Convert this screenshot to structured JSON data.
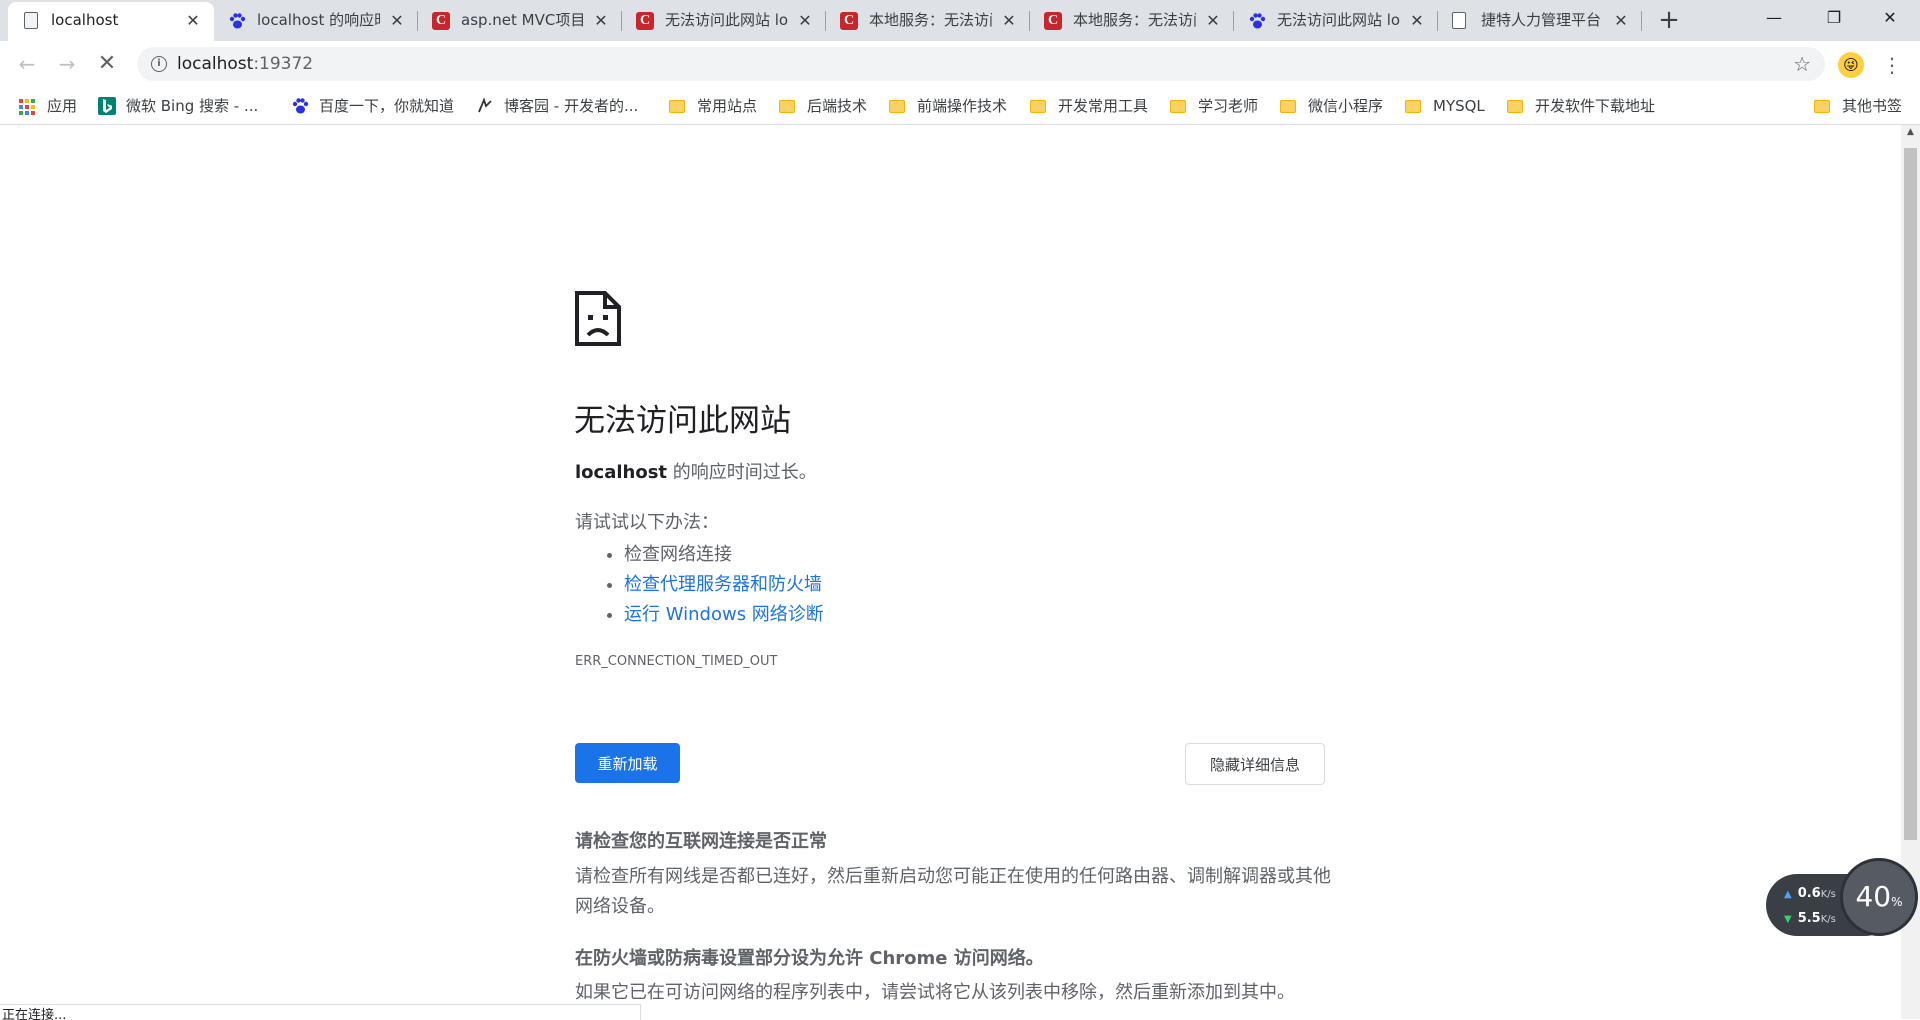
{
  "tabs": [
    {
      "title": "localhost",
      "favicon": "document-icon",
      "active": true
    },
    {
      "title": "localhost 的响应时间过长",
      "favicon": "baidu-icon",
      "active": false
    },
    {
      "title": "asp.net MVC项目",
      "favicon": "csdn-icon",
      "active": false
    },
    {
      "title": "无法访问此网站 localhost",
      "favicon": "csdn-icon",
      "active": false
    },
    {
      "title": "本地服务：无法访问",
      "favicon": "csdn-icon",
      "active": false
    },
    {
      "title": "本地服务：无法访问",
      "favicon": "csdn-icon",
      "active": false
    },
    {
      "title": "无法访问此网站 localhost",
      "favicon": "baidu-icon",
      "active": false
    },
    {
      "title": "捷特人力管理平台",
      "favicon": "document-icon",
      "active": false
    }
  ],
  "omnibox": {
    "host": "localhost",
    "port": ":19372"
  },
  "bookmarks": [
    {
      "label": "应用",
      "icon": "apps-grid-icon"
    },
    {
      "label": "微软 Bing 搜索 - ...",
      "icon": "bing-icon"
    },
    {
      "label": "百度一下，你就知道",
      "icon": "baidu-icon"
    },
    {
      "label": "博客园 - 开发者的...",
      "icon": "cnblogs-icon"
    },
    {
      "label": "常用站点",
      "icon": "folder-icon"
    },
    {
      "label": "后端技术",
      "icon": "folder-icon"
    },
    {
      "label": "前端操作技术",
      "icon": "folder-icon"
    },
    {
      "label": "开发常用工具",
      "icon": "folder-icon"
    },
    {
      "label": "学习老师",
      "icon": "folder-icon"
    },
    {
      "label": "微信小程序",
      "icon": "folder-icon"
    },
    {
      "label": "MYSQL",
      "icon": "folder-icon"
    },
    {
      "label": "开发软件下载地址",
      "icon": "folder-icon"
    }
  ],
  "other_bookmarks": "其他书签",
  "error": {
    "heading": "无法访问此网站",
    "host": "localhost",
    "message": " 的响应时间过长。",
    "suggest_label": "请试试以下办法：",
    "suggestions": [
      "检查网络连接",
      "检查代理服务器和防火墙",
      "运行 Windows 网络诊断"
    ],
    "code": "ERR_CONNECTION_TIMED_OUT",
    "reload_label": "重新加载",
    "details_label": "隐藏详细信息",
    "detail1_heading": "请检查您的互联网连接是否正常",
    "detail1_text": "请检查所有网线是否都已连好，然后重新启动您可能正在使用的任何路由器、调制解调器或其他网络设备。",
    "detail2_heading": "在防火墙或防病毒设置部分设为允许 Chrome 访问网络。",
    "detail2_text": "如果它已在可访问网络的程序列表中，请尝试将它从该列表中移除，然后重新添加到其中。"
  },
  "status_text": "正在连接...",
  "net_widget": {
    "upload": "0.6",
    "download": "5.5",
    "unit": "K/s",
    "gauge_value": "40",
    "gauge_unit": "%"
  },
  "colors": {
    "accent": "#1a73e8",
    "csdn": "#c9252c",
    "folder": "#fad165"
  }
}
